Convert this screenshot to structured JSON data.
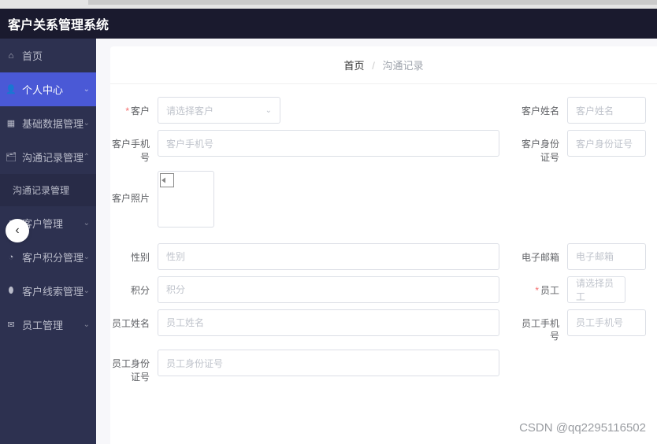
{
  "app_title": "客户关系管理系统",
  "sidebar": {
    "items": [
      {
        "label": "首页",
        "icon": "⌂"
      },
      {
        "label": "个人中心",
        "icon": "👤"
      },
      {
        "label": "基础数据管理",
        "icon": "▦"
      },
      {
        "label": "沟通记录管理",
        "icon": "🗂"
      },
      {
        "label": "沟通记录管理",
        "sub": true
      },
      {
        "label": "客户管理",
        "icon": "▯"
      },
      {
        "label": "客户积分管理",
        "icon": "◔"
      },
      {
        "label": "客户线索管理",
        "icon": "⬮"
      },
      {
        "label": "员工管理",
        "icon": "✉"
      }
    ]
  },
  "breadcrumb": {
    "home": "首页",
    "sep": "/",
    "current": "沟通记录"
  },
  "form": {
    "customer_label": "客户",
    "customer_select_ph": "请选择客户",
    "cust_name_label": "客户姓名",
    "cust_name_ph": "客户姓名",
    "cust_phone_label": "客户手机号",
    "cust_phone_ph": "客户手机号",
    "cust_id_label": "客户身份证号",
    "cust_id_ph": "客户身份证号",
    "cust_photo_label": "客户照片",
    "gender_label": "性别",
    "gender_ph": "性别",
    "email_label": "电子邮箱",
    "email_ph": "电子邮箱",
    "points_label": "积分",
    "points_ph": "积分",
    "emp_label": "员工",
    "emp_select_ph": "请选择员工",
    "emp_name_label": "员工姓名",
    "emp_name_ph": "员工姓名",
    "emp_phone_label": "员工手机号",
    "emp_phone_ph": "员工手机号",
    "emp_id_label": "员工身份证号",
    "emp_id_ph": "员工身份证号",
    "req": "*"
  },
  "watermark": "CSDN @qq2295116502"
}
